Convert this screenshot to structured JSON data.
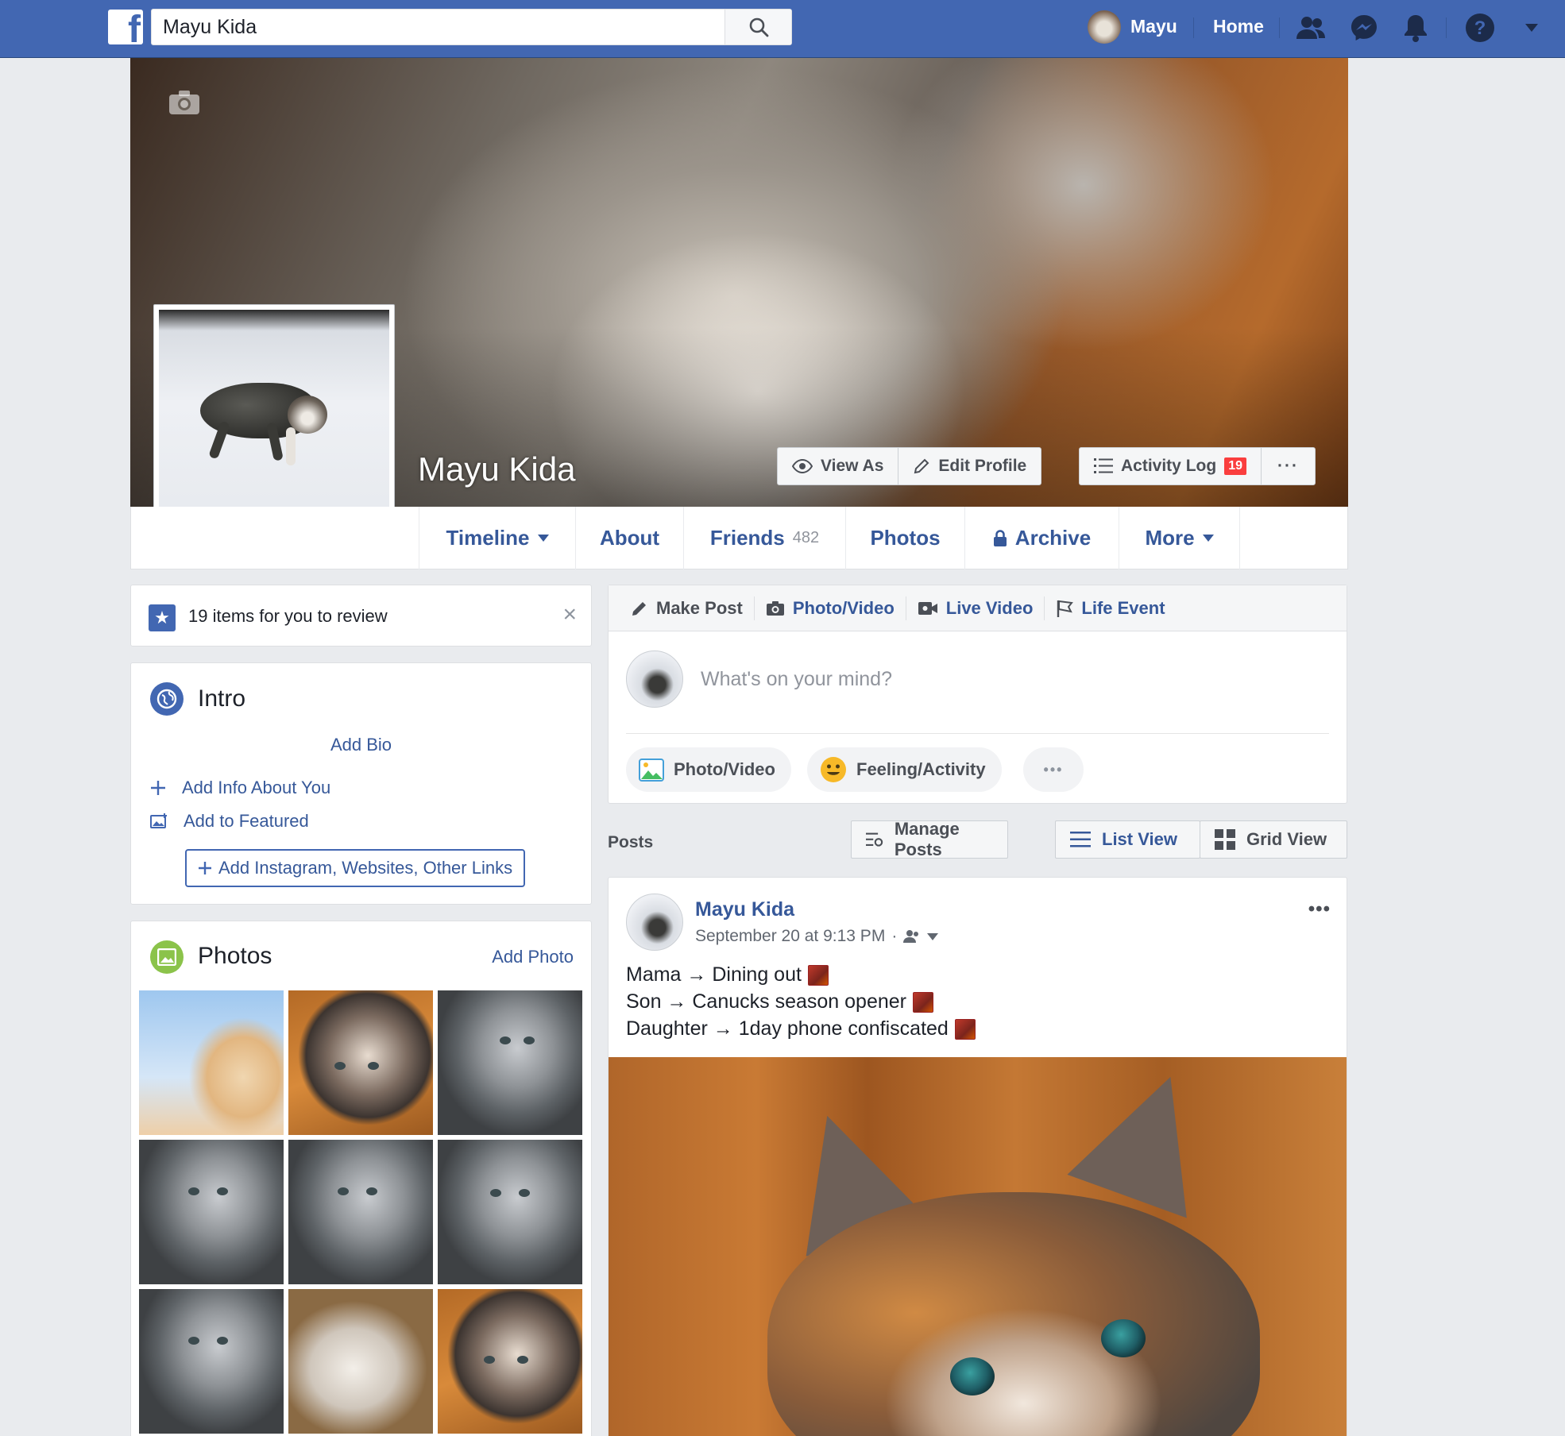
{
  "topbar": {
    "logo_letter": "f",
    "search_value": "Mayu Kida",
    "user_name": "Mayu",
    "home_label": "Home",
    "icons": [
      "search-icon",
      "friends-icon",
      "messenger-icon",
      "notifications-icon",
      "help-icon",
      "caret-down-icon"
    ],
    "brand_color": "#4267b2"
  },
  "cover": {
    "name": "Mayu Kida",
    "view_as": "View As",
    "edit_profile": "Edit Profile",
    "activity_log": "Activity Log",
    "activity_count": "19",
    "more_dots": "···"
  },
  "profile_nav": {
    "tabs": [
      {
        "label": "Timeline"
      },
      {
        "label": "About"
      },
      {
        "label": "Friends",
        "count": "482"
      },
      {
        "label": "Photos"
      },
      {
        "label": "Archive"
      },
      {
        "label": "More"
      }
    ]
  },
  "review": {
    "text": "19 items for you to review",
    "close": "×"
  },
  "intro": {
    "title": "Intro",
    "add_bio": "Add Bio",
    "add_info": "Add Info About You",
    "add_featured": "Add to Featured",
    "add_links": "Add Instagram, Websites, Other Links"
  },
  "photos": {
    "title": "Photos",
    "add_photo": "Add Photo"
  },
  "composer": {
    "tabs": [
      "Make Post",
      "Photo/Video",
      "Live Video",
      "Life Event"
    ],
    "placeholder": "What's on your mind?",
    "photo_video": "Photo/Video",
    "feeling": "Feeling/Activity",
    "more": "•••"
  },
  "posts_bar": {
    "label": "Posts",
    "manage": "Manage Posts",
    "list_view": "List View",
    "grid_view": "Grid View"
  },
  "post": {
    "author": "Mayu Kida",
    "timestamp": "September 20 at 9:13 PM",
    "dot": "·",
    "more": "•••",
    "lines": [
      "Mama → Dining out",
      "Son → Canucks season opener",
      "Daughter → 1day phone confiscated"
    ]
  }
}
